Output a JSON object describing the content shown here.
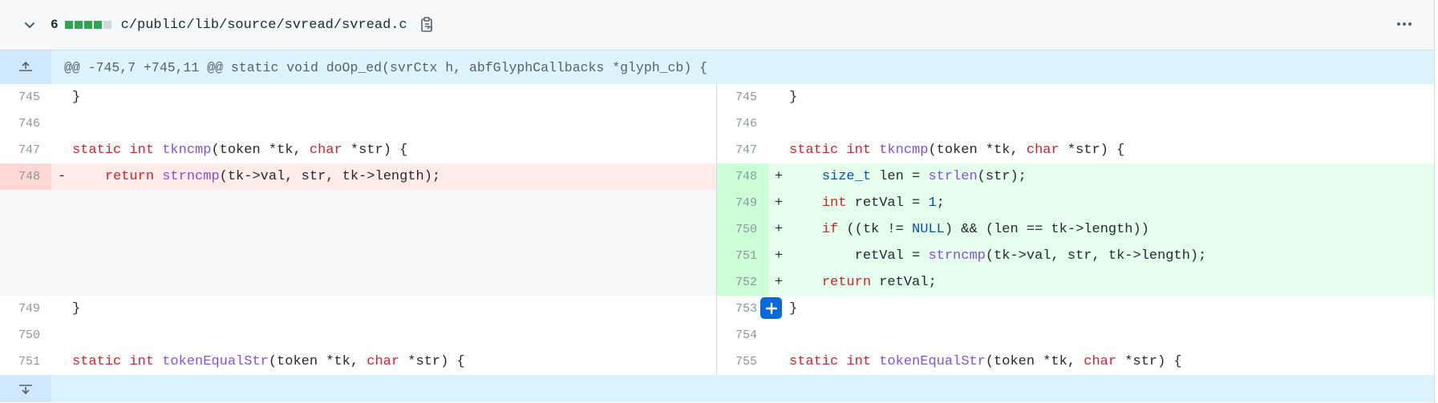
{
  "file": {
    "changes_count": "6",
    "diffstat": [
      "#2da44e",
      "#2da44e",
      "#2da44e",
      "#2da44e",
      "#d0d7de"
    ],
    "path": "c/public/lib/source/svread/svread.c"
  },
  "hunk": {
    "header": "@@ -745,7 +745,11 @@ static void doOp_ed(svrCtx h, abfGlyphCallbacks *glyph_cb) {"
  },
  "left_lines": {
    "l745": "745",
    "l746": "746",
    "l747": "747",
    "l748": "748",
    "l749": "749",
    "l750": "750",
    "l751": "751"
  },
  "right_lines": {
    "r745": "745",
    "r746": "746",
    "r747": "747",
    "r748": "748",
    "r749": "749",
    "r750": "750",
    "r751": "751",
    "r752": "752",
    "r753": "753",
    "r754": "754",
    "r755": "755"
  },
  "tokens": {
    "brace": "}",
    "static": "static",
    "int": "int",
    "tkncmp": "tkncmp",
    "tkncmp_args_a": "(token *tk, ",
    "char": "char",
    "args_b": " *str) {",
    "minus": "-",
    "plus": "+",
    "return": "return",
    "strncmp": "strncmp",
    "strncmp_args": "(tk->val, str, tk->length);",
    "size_t": "size_t",
    "len_assign": " len = ",
    "strlen": "strlen",
    "strlen_args": "(str);",
    "retval_decl": " retVal = ",
    "one": "1",
    "semi": ";",
    "if": "if",
    "if_a": " ((tk != ",
    "null": "NULL",
    "if_b": ") && (len == tk->length))",
    "retval_assign": "retVal = ",
    "return_retval": " retVal;",
    "tokenEqualStr": "tokenEqualStr"
  }
}
